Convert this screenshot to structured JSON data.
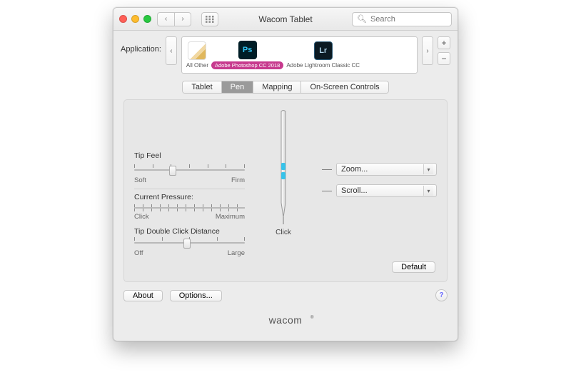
{
  "window": {
    "title": "Wacom Tablet"
  },
  "search": {
    "placeholder": "Search"
  },
  "app_row": {
    "label": "Application:",
    "items": [
      {
        "label": "All Other"
      },
      {
        "label": "Adobe Photoshop CC 2018"
      },
      {
        "label": "Adobe Lightroom Classic CC"
      }
    ]
  },
  "tabs": {
    "items": [
      "Tablet",
      "Pen",
      "Mapping",
      "On-Screen Controls"
    ],
    "active": "Pen"
  },
  "tip_feel": {
    "label": "Tip Feel",
    "min_label": "Soft",
    "max_label": "Firm"
  },
  "pressure": {
    "label": "Current Pressure:",
    "min_label": "Click",
    "max_label": "Maximum"
  },
  "dbl_click": {
    "label": "Tip Double Click Distance",
    "min_label": "Off",
    "max_label": "Large"
  },
  "pen": {
    "tip_label": "Click"
  },
  "side_buttons": {
    "upper": "Zoom...",
    "lower": "Scroll..."
  },
  "buttons": {
    "default": "Default",
    "about": "About",
    "options": "Options..."
  },
  "brand": "wacom"
}
